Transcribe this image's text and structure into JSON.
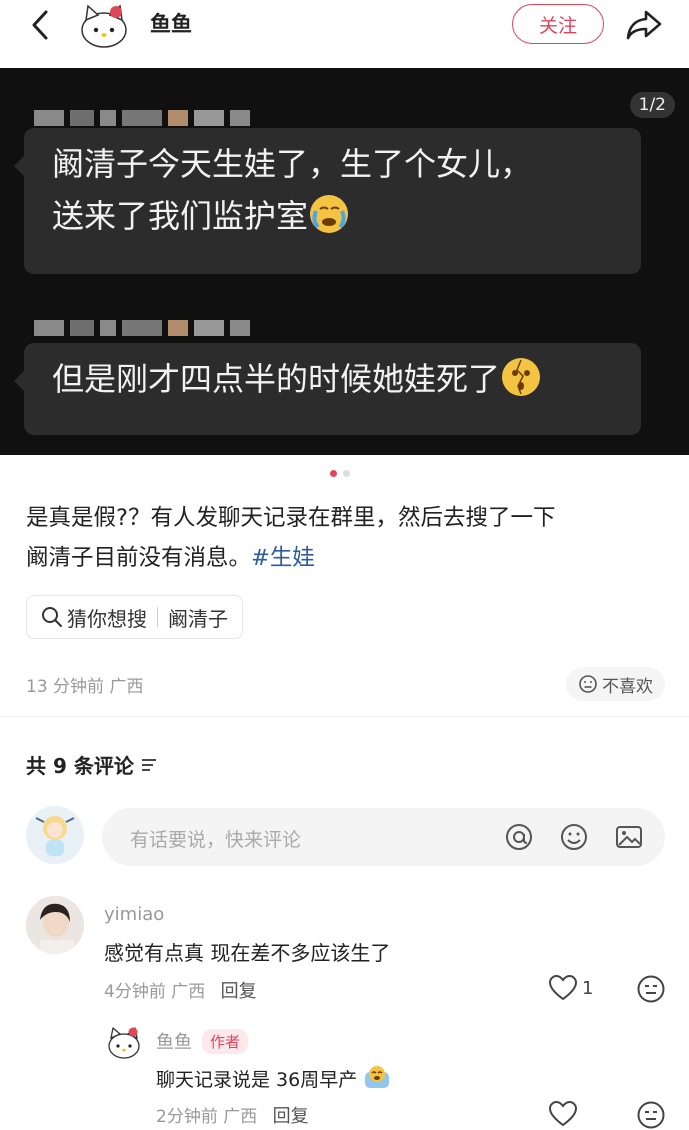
{
  "header": {
    "author": "鱼鱼",
    "follow_label": "关注"
  },
  "image": {
    "pager": "1/2",
    "bubble1_line1": "阚清子今天生娃了，生了个女儿，",
    "bubble1_line2": "送来了我们监护室",
    "bubble2_text": "但是刚才四点半的时候她娃死了"
  },
  "post": {
    "text_line1": "是真是假?？有人发聊天记录在群里，然后去搜了一下",
    "text_line2": "阚清子目前没有消息。",
    "hashtag": "#生娃",
    "guess_label": "猜你想搜",
    "guess_term": "阚清子",
    "time": "13 分钟前",
    "location": "广西",
    "dislike_label": "不喜欢"
  },
  "comments": {
    "title": "共 9 条评论",
    "input_placeholder": "有话要说，快来评论",
    "items": [
      {
        "user": "yimiao",
        "text": "感觉有点真 现在差不多应该生了",
        "time": "4分钟前",
        "location": "广西",
        "reply_label": "回复",
        "likes": "1"
      },
      {
        "user": "鱼鱼",
        "author_tag": "作者",
        "text": "聊天记录说是 36周早产",
        "time": "2分钟前",
        "location": "广西",
        "reply_label": "回复"
      }
    ]
  },
  "colors": {
    "accent": "#e0455a",
    "hashtag": "#2e5c9a",
    "image_bg": "#101010",
    "bubble_bg": "#2c2c2c"
  }
}
